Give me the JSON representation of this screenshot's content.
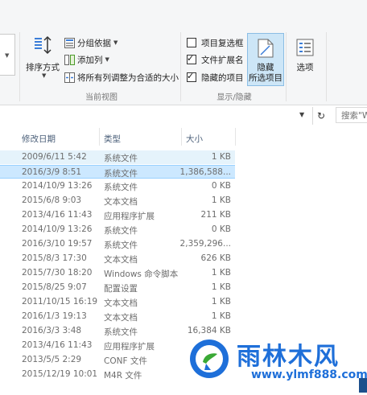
{
  "ribbon": {
    "sort": {
      "label": "排序方式"
    },
    "commands": {
      "group_by": "分组依据",
      "add_column": "添加列",
      "size_all_columns": "将所有列调整为合适的大小"
    },
    "current_view_label": "当前视图",
    "show_hide": {
      "item_checkboxes": {
        "label": "项目复选框",
        "checked": false
      },
      "file_extensions": {
        "label": "文件扩展名",
        "checked": true
      },
      "hidden_items": {
        "label": "隐藏的项目",
        "checked": true
      },
      "tick": "✓"
    },
    "hide_selected": {
      "label_line1": "隐藏",
      "label_line2": "所选项目"
    },
    "show_hide_label": "显示/隐藏",
    "options": {
      "label": "选项"
    }
  },
  "addressbar": {
    "search_placeholder": "搜索\"W"
  },
  "columns": {
    "date": "修改日期",
    "type": "类型",
    "size": "大小"
  },
  "rows": [
    {
      "date": "2009/6/11 5:42",
      "type": "系统文件",
      "size": "1 KB"
    },
    {
      "date": "2016/3/9 8:51",
      "type": "系统文件",
      "size": "1,386,588..."
    },
    {
      "date": "2014/10/9 13:26",
      "type": "系统文件",
      "size": "0 KB"
    },
    {
      "date": "2015/6/8 9:03",
      "type": "文本文档",
      "size": "1 KB"
    },
    {
      "date": "2013/4/16 11:43",
      "type": "应用程序扩展",
      "size": "211 KB"
    },
    {
      "date": "2014/10/9 13:26",
      "type": "系统文件",
      "size": "0 KB"
    },
    {
      "date": "2016/3/10 19:57",
      "type": "系统文件",
      "size": "2,359,296..."
    },
    {
      "date": "2015/8/3 17:30",
      "type": "文本文档",
      "size": "626 KB"
    },
    {
      "date": "2015/7/30 18:20",
      "type": "Windows 命令脚本",
      "size": "1 KB"
    },
    {
      "date": "2015/8/25 9:07",
      "type": "配置设置",
      "size": "1 KB"
    },
    {
      "date": "2011/10/15 16:19",
      "type": "文本文档",
      "size": "1 KB"
    },
    {
      "date": "2016/1/3 19:13",
      "type": "文本文档",
      "size": "1 KB"
    },
    {
      "date": "2016/3/3 3:48",
      "type": "系统文件",
      "size": "16,384 KB"
    },
    {
      "date": "2013/4/16 11:43",
      "type": "应用程序扩展",
      "size": ""
    },
    {
      "date": "2013/5/5 2:29",
      "type": "CONF 文件",
      "size": ""
    },
    {
      "date": "2015/12/19 10:01",
      "type": "M4R 文件",
      "size": ""
    }
  ],
  "watermark": {
    "title": "雨林木风",
    "url": "www.ylmf888.com"
  },
  "colors": {
    "selection": "#cce8ff",
    "hover": "#e5f3fb",
    "header_text": "#4c607a",
    "accent": "#1e6fd9"
  }
}
